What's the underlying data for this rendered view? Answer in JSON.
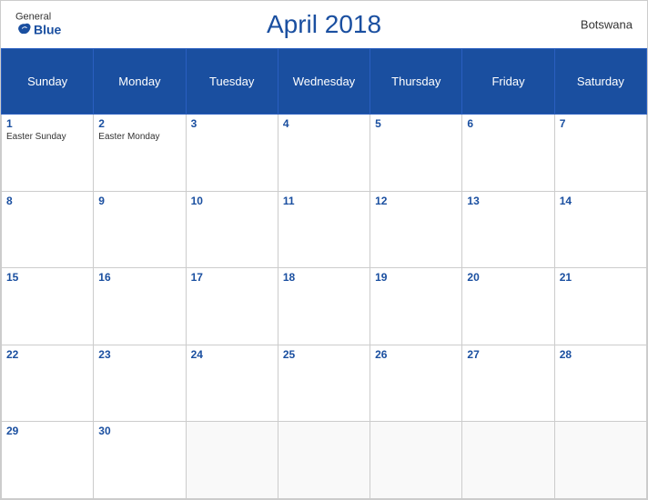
{
  "header": {
    "title": "April 2018",
    "country": "Botswana",
    "logo": {
      "general": "General",
      "blue": "Blue"
    }
  },
  "weekdays": [
    "Sunday",
    "Monday",
    "Tuesday",
    "Wednesday",
    "Thursday",
    "Friday",
    "Saturday"
  ],
  "weeks": [
    [
      {
        "day": 1,
        "holiday": "Easter Sunday"
      },
      {
        "day": 2,
        "holiday": "Easter Monday"
      },
      {
        "day": 3,
        "holiday": ""
      },
      {
        "day": 4,
        "holiday": ""
      },
      {
        "day": 5,
        "holiday": ""
      },
      {
        "day": 6,
        "holiday": ""
      },
      {
        "day": 7,
        "holiday": ""
      }
    ],
    [
      {
        "day": 8,
        "holiday": ""
      },
      {
        "day": 9,
        "holiday": ""
      },
      {
        "day": 10,
        "holiday": ""
      },
      {
        "day": 11,
        "holiday": ""
      },
      {
        "day": 12,
        "holiday": ""
      },
      {
        "day": 13,
        "holiday": ""
      },
      {
        "day": 14,
        "holiday": ""
      }
    ],
    [
      {
        "day": 15,
        "holiday": ""
      },
      {
        "day": 16,
        "holiday": ""
      },
      {
        "day": 17,
        "holiday": ""
      },
      {
        "day": 18,
        "holiday": ""
      },
      {
        "day": 19,
        "holiday": ""
      },
      {
        "day": 20,
        "holiday": ""
      },
      {
        "day": 21,
        "holiday": ""
      }
    ],
    [
      {
        "day": 22,
        "holiday": ""
      },
      {
        "day": 23,
        "holiday": ""
      },
      {
        "day": 24,
        "holiday": ""
      },
      {
        "day": 25,
        "holiday": ""
      },
      {
        "day": 26,
        "holiday": ""
      },
      {
        "day": 27,
        "holiday": ""
      },
      {
        "day": 28,
        "holiday": ""
      }
    ],
    [
      {
        "day": 29,
        "holiday": ""
      },
      {
        "day": 30,
        "holiday": ""
      },
      {
        "day": null,
        "holiday": ""
      },
      {
        "day": null,
        "holiday": ""
      },
      {
        "day": null,
        "holiday": ""
      },
      {
        "day": null,
        "holiday": ""
      },
      {
        "day": null,
        "holiday": ""
      }
    ]
  ]
}
